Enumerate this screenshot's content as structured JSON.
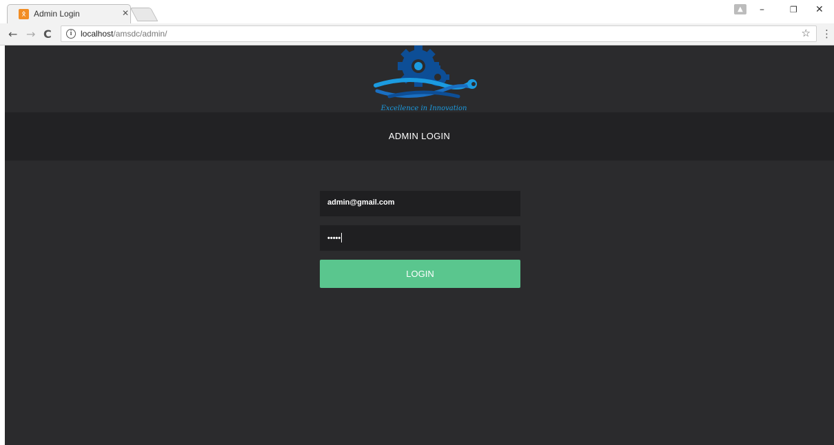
{
  "browser": {
    "tab_title": "Admin Login",
    "url_host": "localhost",
    "url_path": "/amsdc/admin/"
  },
  "page": {
    "logo_tagline": "Excellence in Innovation",
    "heading": "ADMIN LOGIN",
    "email_value": "admin@gmail.com",
    "password_mask": "•••••",
    "login_label": "LOGIN"
  },
  "colors": {
    "page_bg": "#2b2b2d",
    "title_bar_bg": "#222224",
    "field_bg": "#1f1f21",
    "button_bg": "#5ac68e",
    "logo_dark_blue": "#0d4e96",
    "logo_light_blue": "#1b9be0"
  }
}
